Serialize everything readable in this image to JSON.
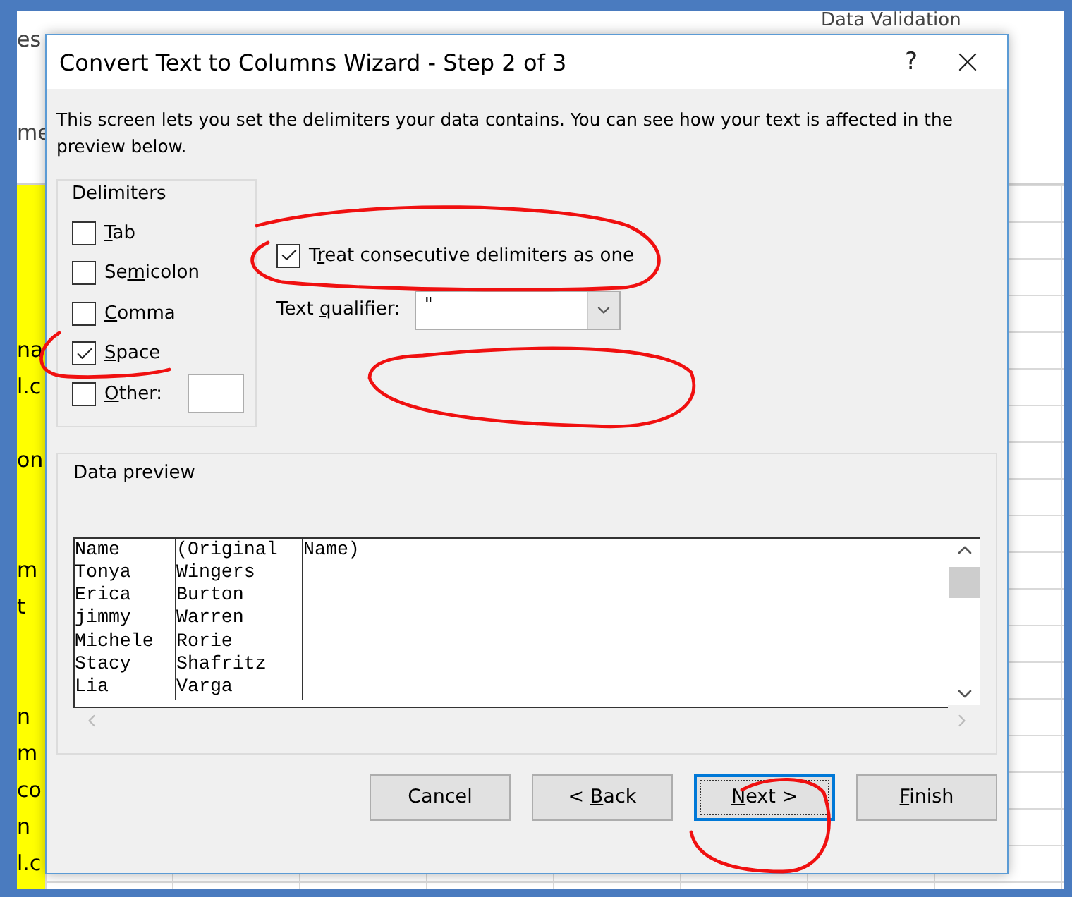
{
  "sheet": {
    "ribbon_fragments": [
      {
        "text": "es"
      },
      {
        "text": "Data Validation"
      }
    ],
    "name_fragment": "me",
    "rows": [
      {},
      {},
      {},
      {},
      {
        "text": "na"
      },
      {
        "text": "l.c"
      },
      {},
      {
        "text": "on"
      },
      {},
      {},
      {
        "text": "m"
      },
      {
        "text": "t"
      },
      {},
      {},
      {
        "text": "n"
      },
      {
        "text": "m"
      },
      {
        "text": "co"
      },
      {
        "text": "n"
      },
      {
        "text": "l.c"
      }
    ]
  },
  "dialog": {
    "title": "Convert Text to Columns Wizard - Step 2 of 3",
    "help": "?",
    "instructions": "This screen lets you set the delimiters your data contains.  You can see how your text is affected in the preview below.",
    "delimiters": {
      "title": "Delimiters",
      "items": [
        {
          "kind": "checkbox",
          "access_key": "T",
          "after": "ab",
          "checked": false
        },
        {
          "kind": "checkbox",
          "before": "Se",
          "access_key": "m",
          "after": "icolon",
          "checked": false
        },
        {
          "kind": "checkbox",
          "access_key": "C",
          "after": "omma",
          "checked": false
        },
        {
          "kind": "checkbox",
          "access_key": "S",
          "after": "pace",
          "checked": true
        },
        {
          "kind": "checkbox_field",
          "access_key": "O",
          "after": "ther:",
          "checked": false
        }
      ]
    },
    "consecutive": {
      "before": "T",
      "access_key": "r",
      "after": "eat consecutive delimiters as one",
      "checked": true
    },
    "text_qualifier": {
      "before": "Text ",
      "access_key": "q",
      "after": "ualifier:",
      "value": "\""
    },
    "data_preview": {
      "title": "Data preview",
      "rows": [
        [
          "Name",
          "(Original",
          "Name)"
        ],
        [
          "Tonya",
          "Wingers",
          ""
        ],
        [
          "Erica",
          "Burton",
          ""
        ],
        [
          "jimmy",
          "Warren",
          ""
        ],
        [
          "Michele",
          "Rorie",
          ""
        ],
        [
          "Stacy",
          "Shafritz",
          ""
        ],
        [
          "Lia",
          "Varga",
          ""
        ]
      ]
    },
    "buttons": [
      {
        "before": "Cancel",
        "focused": false
      },
      {
        "before": "< ",
        "access_key": "B",
        "after": "ack",
        "focused": false
      },
      {
        "access_key": "N",
        "after": "ext >",
        "focused": true
      },
      {
        "access_key": "F",
        "after": "inish",
        "focused": false
      }
    ]
  }
}
